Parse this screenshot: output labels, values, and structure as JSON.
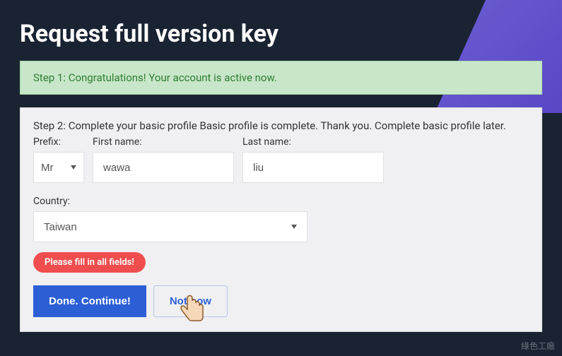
{
  "page": {
    "title": "Request full version key"
  },
  "step1": {
    "text": "Step 1: Congratulations! Your account is active now."
  },
  "step2": {
    "text": "Step 2: Complete your basic profile Basic profile is complete. Thank you. Complete basic profile later.",
    "prefix": {
      "label": "Prefix:",
      "value": "Mr"
    },
    "firstName": {
      "label": "First name:",
      "value": "wawa"
    },
    "lastName": {
      "label": "Last name:",
      "value": "liu"
    },
    "country": {
      "label": "Country:",
      "value": "Taiwan"
    },
    "error": "Please fill in all fields!",
    "buttons": {
      "continue": "Done. Continue!",
      "notNow": "Not now"
    }
  },
  "watermark": "綠色工廠"
}
